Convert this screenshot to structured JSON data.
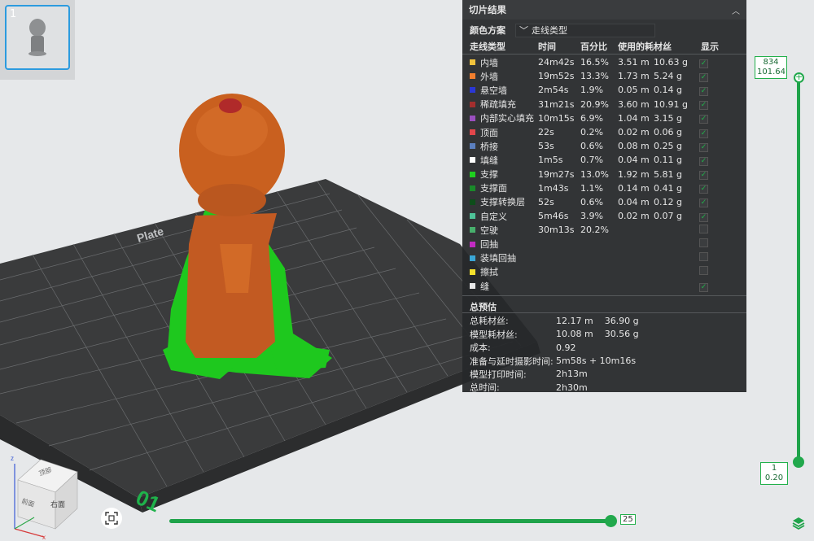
{
  "thumbnail": {
    "index": "1"
  },
  "panel": {
    "title": "切片结果",
    "color_scheme_label": "颜色方案",
    "color_scheme_value": "走线类型",
    "columns": {
      "type": "走线类型",
      "time": "时间",
      "percent": "百分比",
      "usage": "使用的耗材丝",
      "show": "显示"
    },
    "rows": [
      {
        "name": "内墙",
        "time": "24m42s",
        "pct": "16.5%",
        "len": "3.51 m",
        "weight": "10.63 g",
        "color": "#f0c23c",
        "show": true
      },
      {
        "name": "外墙",
        "time": "19m52s",
        "pct": "13.3%",
        "len": "1.73 m",
        "weight": "5.24 g",
        "color": "#f27f2e",
        "show": true
      },
      {
        "name": "悬空墙",
        "time": "2m54s",
        "pct": "1.9%",
        "len": "0.05 m",
        "weight": "0.14 g",
        "color": "#2a37d6",
        "show": true
      },
      {
        "name": "稀疏填充",
        "time": "31m21s",
        "pct": "20.9%",
        "len": "3.60 m",
        "weight": "10.91 g",
        "color": "#a32e2e",
        "show": true
      },
      {
        "name": "内部实心填充",
        "time": "10m15s",
        "pct": "6.9%",
        "len": "1.04 m",
        "weight": "3.15 g",
        "color": "#9a4fc0",
        "show": true
      },
      {
        "name": "顶面",
        "time": "22s",
        "pct": "0.2%",
        "len": "0.02 m",
        "weight": "0.06 g",
        "color": "#e2464b",
        "show": true
      },
      {
        "name": "桥接",
        "time": "53s",
        "pct": "0.6%",
        "len": "0.08 m",
        "weight": "0.25 g",
        "color": "#5b7fbf",
        "show": true
      },
      {
        "name": "填缝",
        "time": "1m5s",
        "pct": "0.7%",
        "len": "0.04 m",
        "weight": "0.11 g",
        "color": "#ffffff",
        "show": true
      },
      {
        "name": "支撑",
        "time": "19m27s",
        "pct": "13.0%",
        "len": "1.92 m",
        "weight": "5.81 g",
        "color": "#1fd01f",
        "show": true
      },
      {
        "name": "支撑面",
        "time": "1m43s",
        "pct": "1.1%",
        "len": "0.14 m",
        "weight": "0.41 g",
        "color": "#1a8a2a",
        "show": true
      },
      {
        "name": "支撑转换层",
        "time": "52s",
        "pct": "0.6%",
        "len": "0.04 m",
        "weight": "0.12 g",
        "color": "#0d4d1a",
        "show": true
      },
      {
        "name": "自定义",
        "time": "5m46s",
        "pct": "3.9%",
        "len": "0.02 m",
        "weight": "0.07 g",
        "color": "#4ec298",
        "show": true
      },
      {
        "name": "空驶",
        "time": "30m13s",
        "pct": "20.2%",
        "len": "",
        "weight": "",
        "color": "#47b06c",
        "show": false
      },
      {
        "name": "回抽",
        "time": "",
        "pct": "",
        "len": "",
        "weight": "",
        "color": "#c22bc2",
        "show": false
      },
      {
        "name": "装填回抽",
        "time": "",
        "pct": "",
        "len": "",
        "weight": "",
        "color": "#3aa6d6",
        "show": false
      },
      {
        "name": "擦拭",
        "time": "",
        "pct": "",
        "len": "",
        "weight": "",
        "color": "#f4e12c",
        "show": false
      },
      {
        "name": "缝",
        "time": "",
        "pct": "",
        "len": "",
        "weight": "",
        "color": "#e8e8e8",
        "show": true
      }
    ],
    "totals_title": "总预估",
    "totals": [
      {
        "label": "总耗材丝:",
        "value": "12.17 m    36.90 g"
      },
      {
        "label": "模型耗材丝:",
        "value": "10.08 m    30.56 g"
      },
      {
        "label": "成本:",
        "value": "0.92"
      },
      {
        "label": "准备与延时摄影时间:",
        "value": "5m58s + 10m16s"
      },
      {
        "label": "模型打印时间:",
        "value": "2h13m"
      },
      {
        "label": "总时间:",
        "value": "2h30m"
      }
    ]
  },
  "layer_slider": {
    "top_layer": "834",
    "top_height": "101.64",
    "bottom_layer": "1",
    "bottom_height": "0.20"
  },
  "move_slider": {
    "value": "25"
  },
  "view_cube": {
    "top": "顶部",
    "front": "前面",
    "right": "右面"
  },
  "plate_text": {
    "number": "01",
    "label": "Plate"
  },
  "colors": {
    "accent": "#1fa34a",
    "model": "#c85d24",
    "support": "#1fc21f"
  }
}
